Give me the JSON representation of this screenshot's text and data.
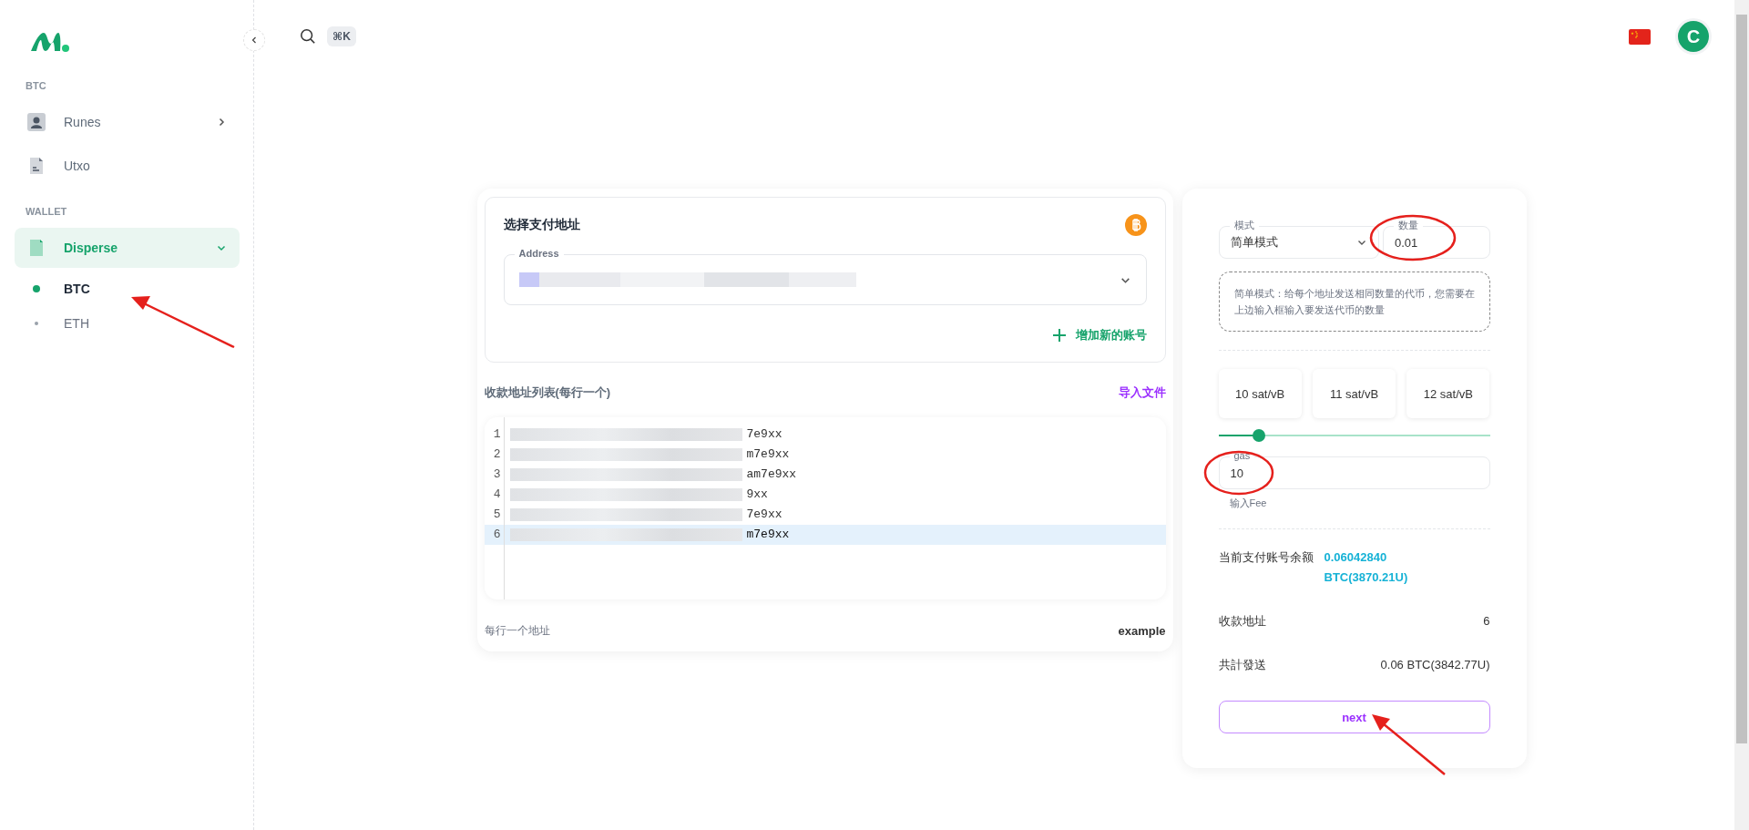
{
  "topbar": {
    "shortcut": "⌘K",
    "avatar": "C"
  },
  "sidebar": {
    "sections": [
      {
        "title": "BTC",
        "items": [
          {
            "label": "Runes",
            "expanded": false,
            "selected": false
          },
          {
            "label": "Utxo",
            "selected": false
          }
        ]
      },
      {
        "title": "WALLET",
        "items": [
          {
            "label": "Disperse",
            "expanded": true,
            "selected": true,
            "children": [
              {
                "label": "BTC",
                "selected": true
              },
              {
                "label": "ETH",
                "selected": false
              }
            ]
          }
        ]
      }
    ]
  },
  "payment": {
    "title": "选择支付地址",
    "address_label": "Address",
    "add_account": "增加新的账号"
  },
  "recipients": {
    "title": "收款地址列表(每行一个)",
    "import": "导入文件",
    "lines": [
      {
        "number": "1",
        "text": "7e9xx",
        "selected": false
      },
      {
        "number": "2",
        "text": "m7e9xx",
        "selected": false
      },
      {
        "number": "3",
        "text": "am7e9xx",
        "selected": false
      },
      {
        "number": "4",
        "text": "9xx",
        "selected": false
      },
      {
        "number": "5",
        "text": "7e9xx",
        "selected": false
      },
      {
        "number": "6",
        "text": "m7e9xx",
        "selected": true
      }
    ],
    "hint": "每行一个地址",
    "example": "example"
  },
  "settings": {
    "mode_label": "模式",
    "mode_value": "简单模式",
    "amount_label": "数量",
    "amount_value": "0.01",
    "description": "简单模式：给每个地址发送相同数量的代币，您需要在上边输入框输入要发送代币的数量",
    "fee_options": [
      {
        "label": "10 sat/vB"
      },
      {
        "label": "11 sat/vB"
      },
      {
        "label": "12 sat/vB"
      }
    ],
    "gas_slider": {
      "level": 0.15
    },
    "gas_label": "gas",
    "gas_value": "10",
    "gas_hint": "输入Fee",
    "summary": [
      {
        "label": "当前支付账号余额",
        "value": "0.06042840 BTC(3870.21U)",
        "kind": "balance"
      },
      {
        "label": "收款地址",
        "value": "6",
        "kind": "plain"
      },
      {
        "label": "共計發送",
        "value": "0.06 BTC(3842.77U)",
        "kind": "plain"
      }
    ],
    "next": "next"
  }
}
